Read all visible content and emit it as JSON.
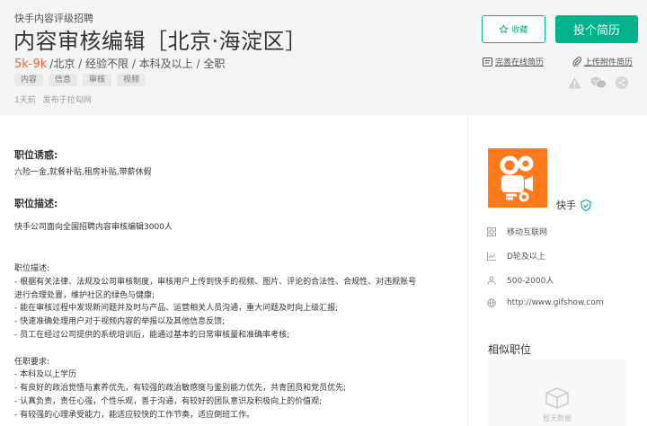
{
  "header": {
    "company_line": "快手内容评级招聘",
    "job_title": "内容审核编辑［北京·海淀区］",
    "salary": "5k-9k",
    "requirements": "/北京 / 经验不限 / 本科及以上 / 全职",
    "tags": [
      "内容",
      "信息",
      "审核",
      "视频"
    ],
    "publish_time": "1天前",
    "publish_source": "发布于拉勾网"
  },
  "actions": {
    "collect_label": "收藏",
    "apply_label": "投个简历",
    "online_resume_label": "完善在线简历",
    "upload_resume_label": "上传附件简历"
  },
  "content": {
    "benefits_title": "职位诱惑:",
    "benefits_text": "六险一金,就餐补贴,租房补贴,带薪休假",
    "desc_title": "职位描述:",
    "desc_intro": "快手公司面向全国招聘内容审核编辑3000人",
    "desc_lines": [
      "职位描述:",
      "- 根据有关法律、法规及公司审核制度，审核用户上传到快手的视频、图片、评论的合法性、合规性、对违规账号",
      "进行合理处置，维护社区的绿色与健康;",
      "- 能在审核过程中发现新问题并及时与产品、运营相关人员沟通，重大问题及时向上级汇报;",
      "- 快速准确处理用户对于视频内容的举报以及其他信息反馈;",
      "- 员工在经过公司提供的系统培训后，能通过基本的日常审核量和准确率考核;",
      "",
      "任职要求:",
      "- 本科及以上学历",
      "- 有良好的政治觉悟与素养优先，有较强的政治敏感度与鉴别能力优先，共青团员和党员优先;",
      "- 认真负责，责任心强，个性乐观，善于沟通，有较好的团队意识及积极向上的价值观;",
      "- 有较强的心理承受能力，能适应较快的工作节奏，适应倒班工作。"
    ]
  },
  "sidebar": {
    "company_name": "快手",
    "industry": "移动互联网",
    "stage": "D轮及以上",
    "size": "500-2000人",
    "website": "http://www.gifshow.com",
    "similar_title": "相似职位",
    "empty_text": "暂无数据"
  },
  "colors": {
    "accent": "#00b38a",
    "salary": "#fd5f39",
    "logo": "#ff7a1a"
  },
  "icons": [
    "star-icon",
    "resume-icon",
    "paperclip-icon",
    "warning-icon",
    "wechat-icon",
    "share-icon",
    "verified-icon",
    "grid-icon",
    "chart-icon",
    "people-icon",
    "globe-icon",
    "empty-box-icon"
  ]
}
